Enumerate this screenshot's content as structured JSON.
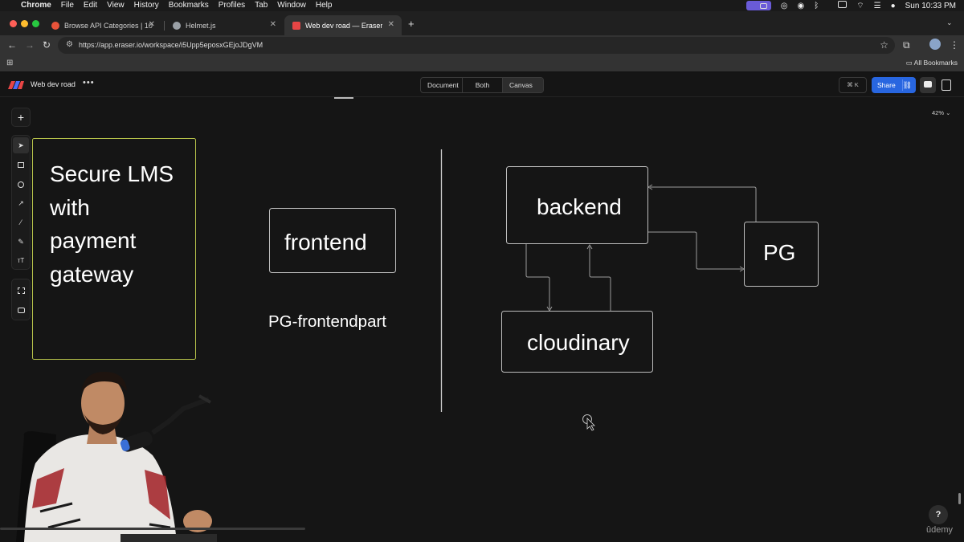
{
  "menubar": {
    "items": [
      "Chrome",
      "File",
      "Edit",
      "View",
      "History",
      "Bookmarks",
      "Profiles",
      "Tab",
      "Window",
      "Help"
    ],
    "clock": "Sun 10:33 PM"
  },
  "tabs": [
    {
      "label": "Browse API Categories | 10,0",
      "favicon_color": "#e8533a",
      "active": false
    },
    {
      "label": "Helmet.js",
      "favicon_color": "#9aa0a6",
      "active": false
    },
    {
      "label": "Web dev road — Eraser",
      "favicon_color": "#e84545",
      "active": true
    }
  ],
  "addressbar": {
    "url": "https://app.eraser.io/workspace/i5Upp5eposxGEjoJDgVM"
  },
  "bookmarks": {
    "all_bookmarks": "All Bookmarks"
  },
  "app": {
    "title": "Web dev road",
    "view_modes": [
      "Document",
      "Both",
      "Canvas"
    ],
    "selected_view": "Canvas",
    "shortcut": "⌘ K",
    "share_label": "Share",
    "zoom": "42%"
  },
  "diagram": {
    "note_box": {
      "lines": [
        "Secure LMS",
        "with",
        "payment",
        "gateway"
      ]
    },
    "frontend_label": "frontend",
    "pg_frontend_caption": "PG-frontendpart",
    "backend_label": "backend",
    "pg_label": "PG",
    "cloudinary_label": "cloudinary"
  },
  "help_label": "?",
  "watermark": "ûdemy",
  "colors": {
    "canvas_bg": "#151515",
    "accent_share": "#2866e0",
    "note_border": "#b6c24a",
    "shape_stroke": "#bdbdbd"
  }
}
